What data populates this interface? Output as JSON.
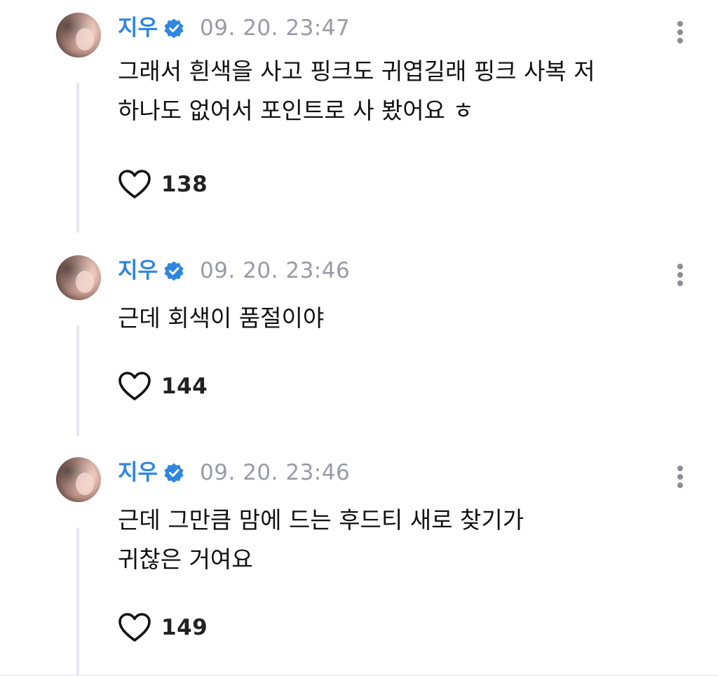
{
  "colors": {
    "author_name": "#2f86e0",
    "verified_badge": "#2f86e0",
    "timestamp": "#9a9aa6",
    "thread_line": "#e6e6ef",
    "text": "#111111"
  },
  "icons": {
    "verified": "verified-badge-icon",
    "more": "more-vertical-icon",
    "like": "heart-outline-icon"
  },
  "posts": [
    {
      "author": "지우",
      "timestamp": "09. 20. 23:47",
      "lines": [
        "그래서 흰색을 사고 핑크도 귀엽길래 핑크 사복 저",
        "하나도 없어서 포인트로 사 봤어요 ㅎ"
      ],
      "likes": "138"
    },
    {
      "author": "지우",
      "timestamp": "09. 20. 23:46",
      "lines": [
        "근데 회색이 품절이야"
      ],
      "likes": "144"
    },
    {
      "author": "지우",
      "timestamp": "09. 20. 23:46",
      "lines": [
        "근데 그만큼 맘에 드는 후드티 새로 찾기가",
        "귀찮은 거여요"
      ],
      "likes": "149"
    }
  ]
}
